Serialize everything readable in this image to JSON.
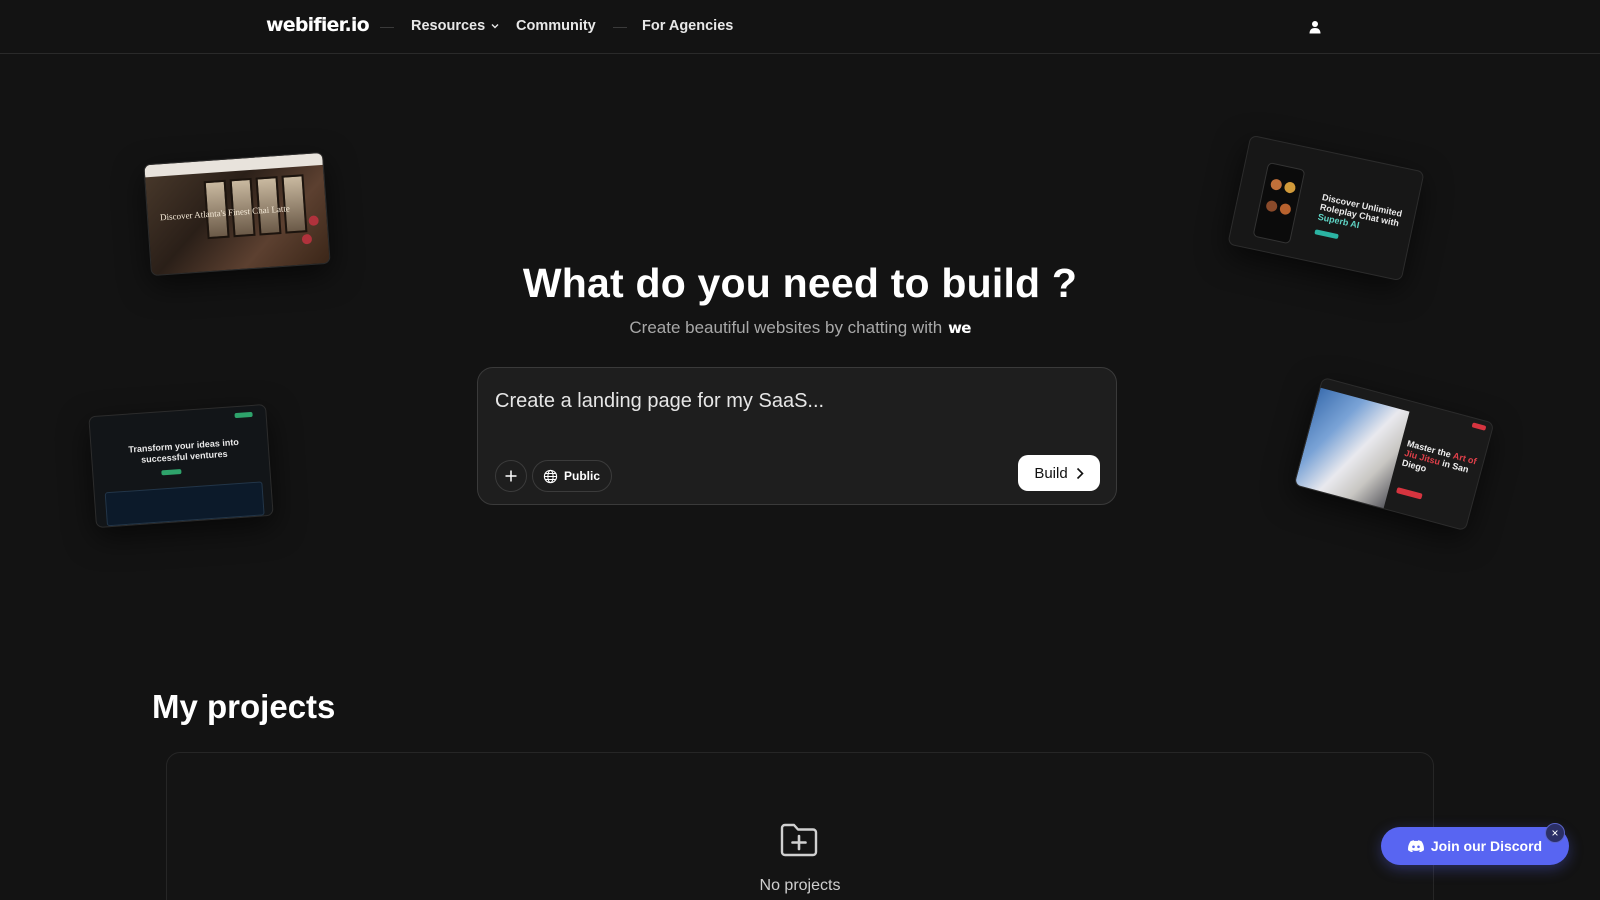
{
  "header": {
    "logo": "webifier.io",
    "nav": {
      "resources": "Resources",
      "community": "Community",
      "agencies": "For Agencies"
    }
  },
  "previews": {
    "cafe": "Discover Atlanta's Finest Chai Latte",
    "saas": "Transform your ideas into successful ventures",
    "ai_prefix": "Discover Unlimited Roleplay Chat with",
    "ai_highlight": "Superb AI",
    "jj_prefix": "Master the",
    "jj_highlight": "Art of Jiu Jitsu",
    "jj_suffix": "in San Diego"
  },
  "hero": {
    "title": "What do you need to build ?",
    "subtitle": "Create beautiful websites by chatting with",
    "we_logo": "we"
  },
  "prompt": {
    "placeholder": "Create a landing page for my SaaS...",
    "visibility_label": "Public",
    "build_label": "Build"
  },
  "projects": {
    "title": "My projects",
    "empty_text": "No projects"
  },
  "discord": {
    "label": "Join our Discord",
    "close": "×"
  },
  "colors": {
    "background": "#131313",
    "prompt_bg": "#1e1e1e",
    "discord": "#5865f2"
  },
  "icons": [
    "chevron-down-icon",
    "user-icon",
    "plus-icon",
    "globe-icon",
    "chevron-right-icon",
    "folder-plus-icon",
    "discord-icon",
    "close-icon"
  ]
}
